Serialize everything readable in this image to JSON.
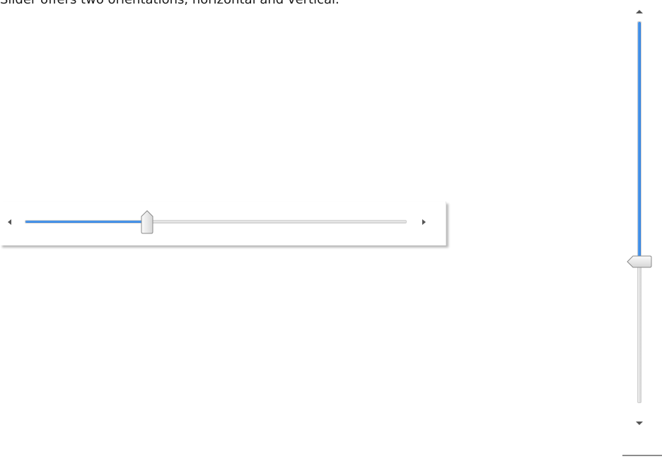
{
  "caption": "Slider offers two orientations, horizontal and vertical.",
  "horizontal_slider": {
    "value_fraction": 0.32,
    "decrease_icon": "triangle-left-icon",
    "increase_icon": "triangle-right-icon",
    "accent_color": "#2c7fe0"
  },
  "vertical_slider": {
    "value_fraction": 0.63,
    "increase_icon": "triangle-up-icon",
    "decrease_icon": "triangle-down-icon",
    "accent_color": "#2c7fe0"
  }
}
